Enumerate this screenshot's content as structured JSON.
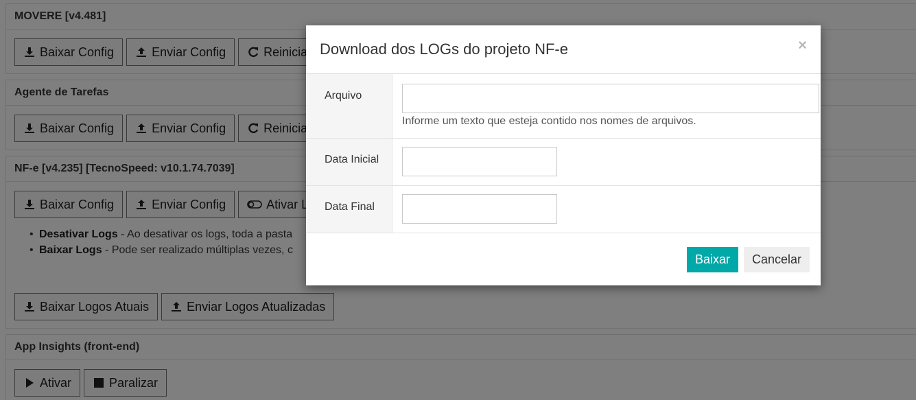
{
  "panels": {
    "movere": {
      "title": "MOVERE [v4.481]",
      "buttons": [
        "Baixar Config",
        "Enviar Config",
        "Reiniciar"
      ]
    },
    "agente": {
      "title": "Agente de Tarefas",
      "buttons": [
        "Baixar Config",
        "Enviar Config",
        "Reiniciar"
      ]
    },
    "nfe": {
      "title": "NF-e [v4.235] [TecnoSpeed: v10.1.74.7039]",
      "buttons": [
        "Baixar Config",
        "Enviar Config",
        "Ativar Lo"
      ],
      "notes": [
        {
          "bold": "Desativar Logs",
          "text": " - Ao desativar os logs, toda a pasta"
        },
        {
          "bold": "Baixar Logs",
          "text": " - Pode ser realizado múltiplas vezes, c"
        }
      ],
      "logo_buttons": [
        "Baixar Logos Atuais",
        "Enviar Logos Atualizadas"
      ]
    },
    "insights": {
      "title": "App Insights (front-end)",
      "buttons": [
        "Ativar",
        "Paralizar"
      ]
    }
  },
  "modal": {
    "title": "Download dos LOGs do projeto NF-e",
    "close": "×",
    "fields": {
      "arquivo_label": "Arquivo",
      "arquivo_value": "",
      "arquivo_help": "Informe um texto que esteja contido nos nomes de arquivos.",
      "data_inicial_label": "Data Inicial",
      "data_inicial_value": "",
      "data_final_label": "Data Final",
      "data_final_value": ""
    },
    "primary_button": "Baixar",
    "secondary_button": "Cancelar",
    "colors": {
      "primary": "#00a8a8",
      "secondary": "#eeeeee"
    }
  }
}
